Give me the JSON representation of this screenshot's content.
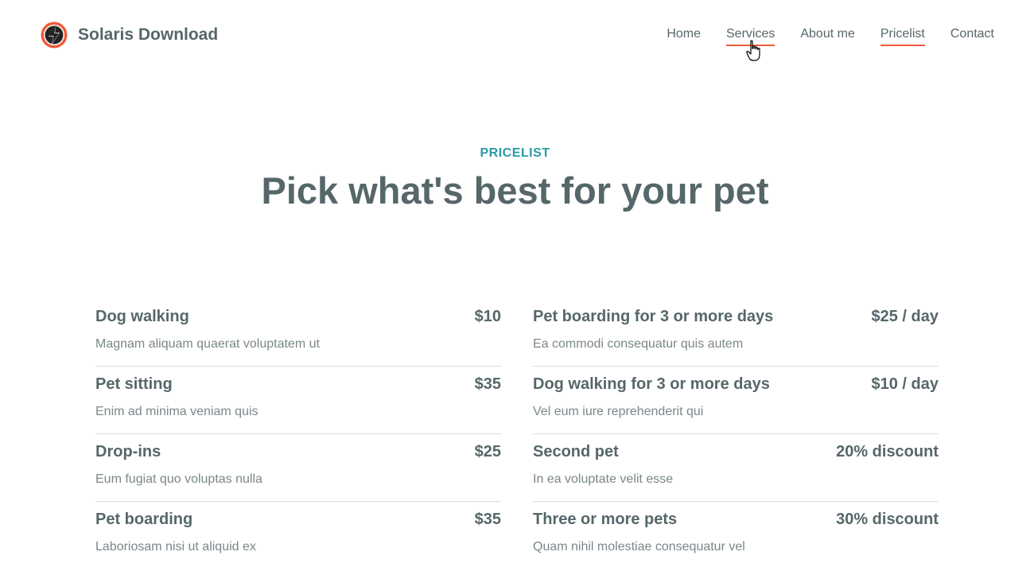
{
  "brand": {
    "name": "Solaris Download"
  },
  "nav": [
    {
      "label": "Home",
      "underline": false
    },
    {
      "label": "Services",
      "underline": true
    },
    {
      "label": "About me",
      "underline": false
    },
    {
      "label": "Pricelist",
      "underline": true
    },
    {
      "label": "Contact",
      "underline": false
    }
  ],
  "section": {
    "eyebrow": "PRICELIST",
    "title": "Pick what's best for your pet"
  },
  "pricelist": {
    "left": [
      {
        "name": "Dog walking",
        "price": "$10",
        "desc": "Magnam aliquam quaerat voluptatem ut"
      },
      {
        "name": "Pet sitting",
        "price": "$35",
        "desc": "Enim ad minima veniam quis"
      },
      {
        "name": "Drop-ins",
        "price": "$25",
        "desc": "Eum fugiat quo voluptas nulla"
      },
      {
        "name": "Pet boarding",
        "price": "$35",
        "desc": "Laboriosam nisi ut aliquid ex"
      }
    ],
    "right": [
      {
        "name": "Pet boarding for 3 or more days",
        "price": "$25 / day",
        "desc": "Ea commodi consequatur quis autem"
      },
      {
        "name": "Dog walking for 3 or more days",
        "price": "$10 / day",
        "desc": "Vel eum iure reprehenderit qui"
      },
      {
        "name": "Second pet",
        "price": "20% discount",
        "desc": "In ea voluptate velit esse"
      },
      {
        "name": "Three or more pets",
        "price": "30% discount",
        "desc": "Quam nihil molestiae consequatur vel"
      }
    ]
  },
  "colors": {
    "accent": "#f05a3a",
    "teal": "#2a9aa5",
    "text": "#56676a"
  },
  "icons": {
    "logo": "lightning-bolt-icon",
    "cursor": "hand-pointer-icon"
  }
}
